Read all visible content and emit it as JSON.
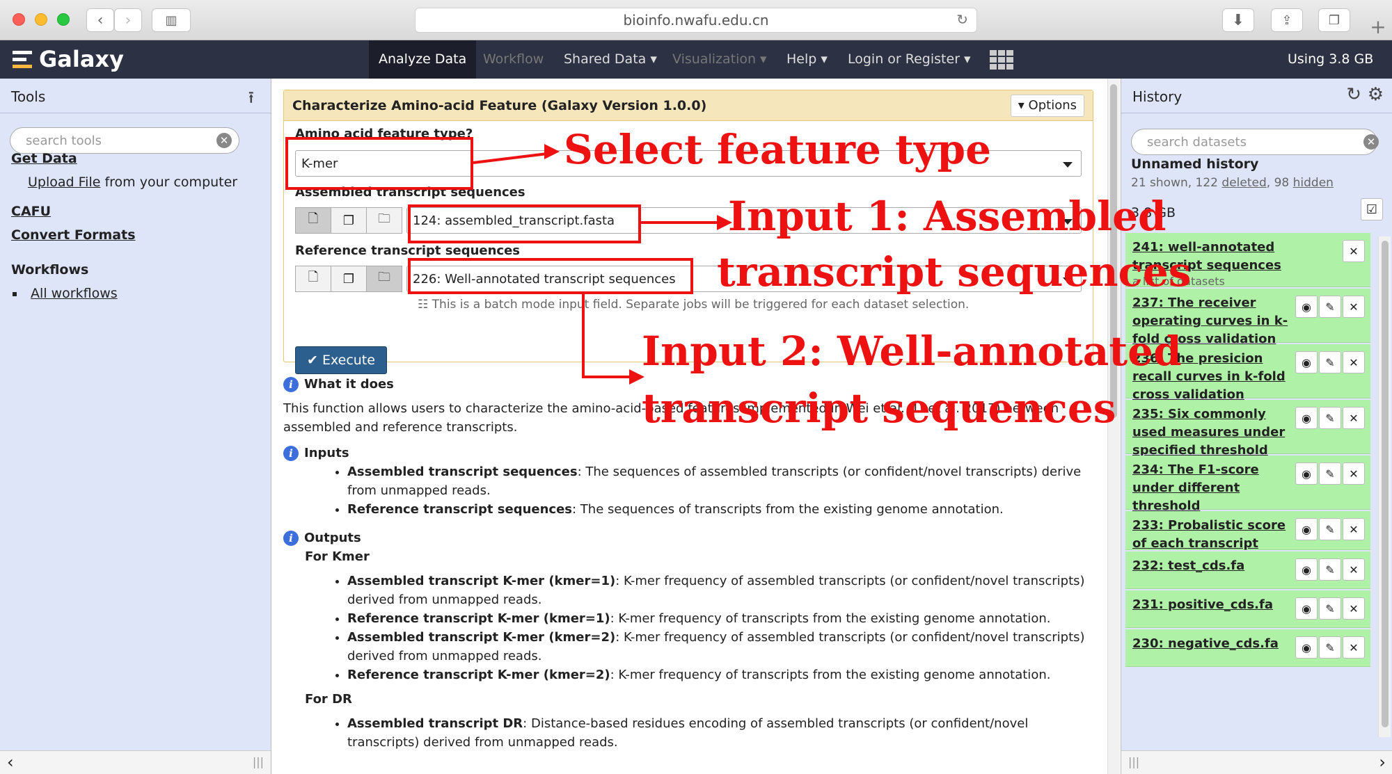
{
  "browser": {
    "url": "bioinfo.nwafu.edu.cn"
  },
  "navbar": {
    "brand": "Galaxy",
    "items": [
      "Analyze Data",
      "Workflow",
      "Shared Data",
      "Visualization",
      "Help",
      "Login or Register"
    ],
    "usage": "Using 3.8 GB"
  },
  "tools": {
    "title": "Tools",
    "search_placeholder": "search tools",
    "get_data": "Get Data",
    "upload_file": "Upload File",
    "upload_suffix": "from your computer",
    "cafu": "CAFU",
    "convert_formats": "Convert Formats",
    "workflows": "Workflows",
    "all_workflows": "All workflows"
  },
  "form": {
    "title": "Characterize Amino-acid Feature (Galaxy Version 1.0.0)",
    "options": "Options",
    "feature_label": "Amino acid feature type?",
    "feature_value": "K-mer",
    "assembled_label": "Assembled transcript sequences",
    "assembled_value": "124: assembled_transcript.fasta",
    "reference_label": "Reference transcript sequences",
    "reference_value": "226: Well-annotated transcript sequences",
    "batch_note": "This is a batch mode input field. Separate jobs will be triggered for each dataset selection.",
    "execute": "Execute"
  },
  "help": {
    "what_title": "What it does",
    "what_text": "This function allows users to characterize the amino-acid-based features implemented in Wei et al. (Li et al. 2017) between assembled and reference transcripts.",
    "inputs_title": "Inputs",
    "inputs": [
      {
        "bold": "Assembled transcript sequences",
        "text": ": The sequences of assembled transcripts (or confident/novel transcripts) derive from unmapped reads."
      },
      {
        "bold": "Reference transcript sequences",
        "text": ": The sequences of transcripts from the existing genome annotation."
      }
    ],
    "outputs_title": "Outputs",
    "for_kmer": "For Kmer",
    "kmer_items": [
      {
        "bold": "Assembled transcript K-mer (kmer=1)",
        "text": ": K-mer frequency of assembled transcripts (or confident/novel transcripts) derived from unmapped reads."
      },
      {
        "bold": "Reference transcript K-mer (kmer=1)",
        "text": ": K-mer frequency of transcripts from the existing genome annotation."
      },
      {
        "bold": "Assembled transcript K-mer (kmer=2)",
        "text": ": K-mer frequency of assembled transcripts (or confident/novel transcripts) derived from unmapped reads."
      },
      {
        "bold": "Reference transcript K-mer (kmer=2)",
        "text": ": K-mer frequency of transcripts from the existing genome annotation."
      }
    ],
    "for_dr": "For DR",
    "dr_items": [
      {
        "bold": "Assembled transcript DR",
        "text": ": Distance-based residues encoding of assembled transcripts (or confident/novel transcripts) derived from unmapped reads."
      }
    ]
  },
  "history": {
    "title": "History",
    "search_placeholder": "search datasets",
    "name": "Unnamed history",
    "shown": "21 shown, 122",
    "deleted": "deleted",
    "hidden_count": ", 98",
    "hidden": "hidden",
    "size": "3.8 GB",
    "items": [
      {
        "title": "241: well-annotated transcript sequences",
        "sub": "a list of datasets"
      },
      {
        "title": "237: The receiver operating curves in k-fold cross validation"
      },
      {
        "title": "236: The presicion recall curves in k-fold cross validation"
      },
      {
        "title": "235: Six commonly used measures under specified threshold"
      },
      {
        "title": "234: The F1-score under different threshold"
      },
      {
        "title": "233: Probalistic score of each transcript"
      },
      {
        "title": "232: test_cds.fa"
      },
      {
        "title": "231: positive_cds.fa"
      },
      {
        "title": "230: negative_cds.fa"
      }
    ]
  },
  "annotations": {
    "select": "Select feature type",
    "input1_a": "Input 1: Assembled",
    "input1_b": "transcript sequences",
    "input2_a": "Input 2: Well-annotated",
    "input2_b": "transcript sequences"
  }
}
